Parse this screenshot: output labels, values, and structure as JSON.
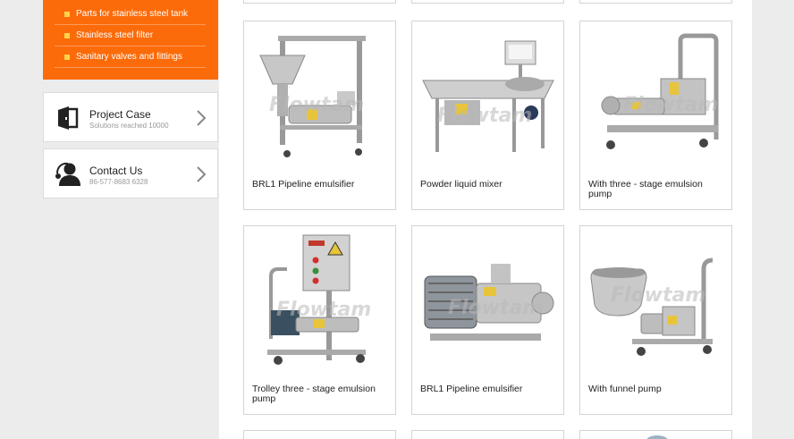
{
  "sidebar": {
    "menu": [
      {
        "label": "Parts for stainless steel tank"
      },
      {
        "label": "Stainless steel filter"
      },
      {
        "label": "Sanitary valves and fittings"
      }
    ],
    "project": {
      "title": "Project Case",
      "subtitle": "Solutions reached 10000"
    },
    "contact": {
      "title": "Contact Us",
      "subtitle": "86-577-8683 6328"
    }
  },
  "watermark": "Flowtam",
  "products": [
    {
      "label": "BRL1 Pipeline emulsifier"
    },
    {
      "label": "Powder liquid mixer"
    },
    {
      "label": "With three - stage emulsion pump"
    },
    {
      "label": "Trolley three - stage emulsion pump"
    },
    {
      "label": "BRL1 Pipeline emulsifier"
    },
    {
      "label": "With funnel pump"
    }
  ],
  "colors": {
    "accent": "#fc6b0a",
    "bullet": "#ffd24a",
    "background": "#ececec"
  }
}
